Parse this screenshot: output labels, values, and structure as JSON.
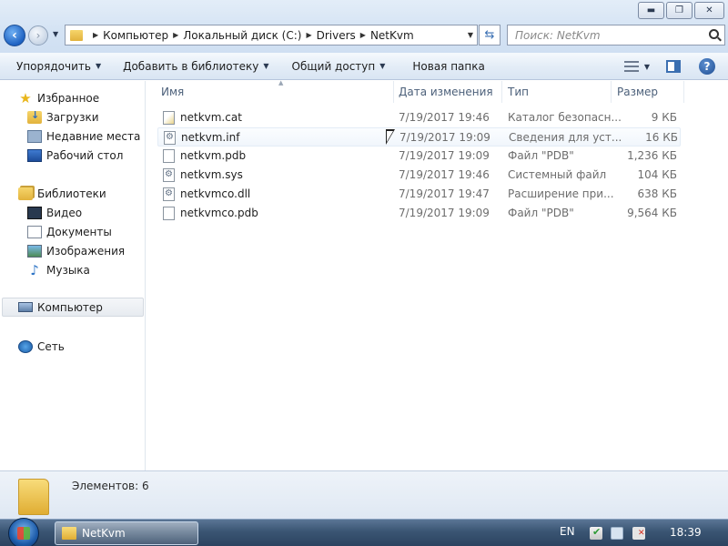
{
  "window": {
    "minimize": "▬",
    "maximize": "❐",
    "close": "✕"
  },
  "address": {
    "crumbs": [
      "Компьютер",
      "Локальный диск (C:)",
      "Drivers",
      "NetKvm"
    ]
  },
  "search": {
    "placeholder": "Поиск: NetKvm"
  },
  "toolbar": {
    "organize": "Упорядочить",
    "add_library": "Добавить в библиотеку",
    "share": "Общий доступ",
    "new_folder": "Новая папка"
  },
  "nav": {
    "favorites": "Избранное",
    "downloads": "Загрузки",
    "recent": "Недавние места",
    "desktop": "Рабочий стол",
    "libraries": "Библиотеки",
    "video": "Видео",
    "documents": "Документы",
    "images": "Изображения",
    "music": "Музыка",
    "computer": "Компьютер",
    "network": "Сеть"
  },
  "columns": {
    "name": "Имя",
    "date": "Дата изменения",
    "type": "Тип",
    "size": "Размер"
  },
  "files": [
    {
      "name": "netkvm.cat",
      "date": "7/19/2017 19:46",
      "type": "Каталог безопасн...",
      "size": "9 КБ",
      "icon": "catalog-file-icon"
    },
    {
      "name": "netkvm.inf",
      "date": "7/19/2017 19:09",
      "type": "Сведения для уст...",
      "size": "16 КБ",
      "icon": "setup-info-file-icon"
    },
    {
      "name": "netkvm.pdb",
      "date": "7/19/2017 19:09",
      "type": "Файл \"PDB\"",
      "size": "1,236 КБ",
      "icon": "generic-file-icon"
    },
    {
      "name": "netkvm.sys",
      "date": "7/19/2017 19:46",
      "type": "Системный файл",
      "size": "104 КБ",
      "icon": "system-file-icon"
    },
    {
      "name": "netkvmco.dll",
      "date": "7/19/2017 19:47",
      "type": "Расширение при...",
      "size": "638 КБ",
      "icon": "dll-file-icon"
    },
    {
      "name": "netkvmco.pdb",
      "date": "7/19/2017 19:09",
      "type": "Файл \"PDB\"",
      "size": "9,564 КБ",
      "icon": "generic-file-icon"
    }
  ],
  "status": {
    "items_count": "Элементов: 6"
  },
  "taskbar": {
    "window_title": "NetKvm",
    "language": "EN",
    "time": "18:39"
  }
}
